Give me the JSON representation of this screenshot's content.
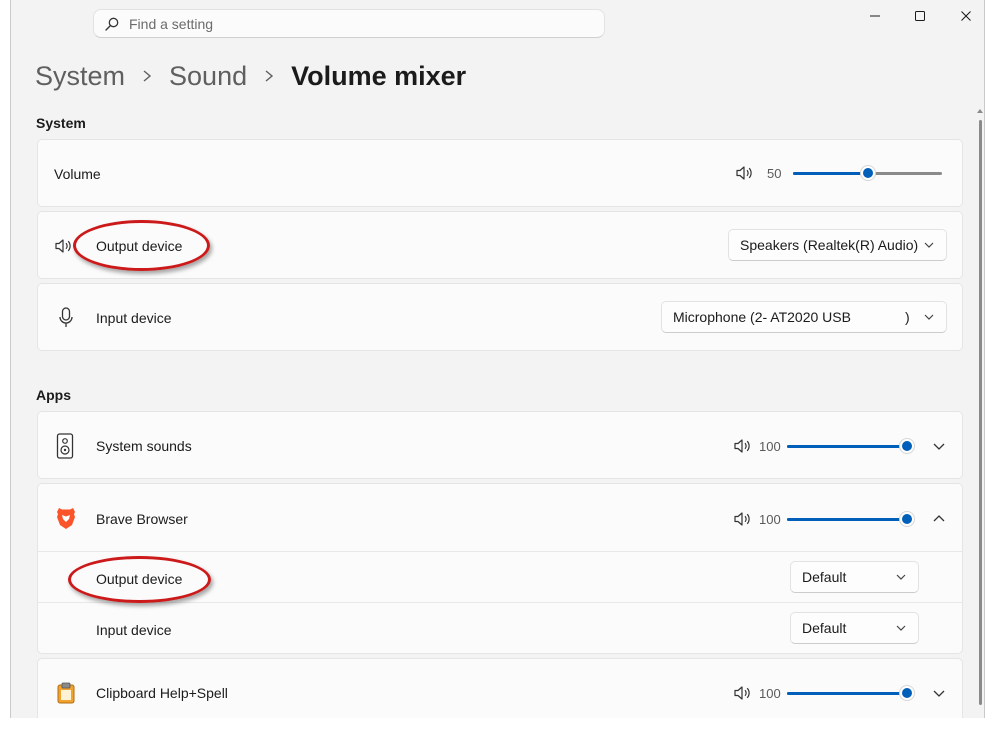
{
  "search": {
    "placeholder": "Find a setting"
  },
  "breadcrumb": {
    "items": [
      "System",
      "Sound",
      "Volume mixer"
    ]
  },
  "system_section": {
    "label": "System",
    "volume": {
      "label": "Volume",
      "value": "50",
      "level": 0.5
    },
    "output": {
      "label": "Output device",
      "selected": "Speakers (Realtek(R) Audio)"
    },
    "input": {
      "label": "Input device",
      "selected": "Microphone (2- AT2020 USB",
      "suffix": ")"
    }
  },
  "apps_section": {
    "label": "Apps",
    "system_sounds": {
      "label": "System sounds",
      "value": "100",
      "level": 1.0
    },
    "brave": {
      "label": "Brave Browser",
      "value": "100",
      "level": 1.0,
      "output_label": "Output device",
      "output_selected": "Default",
      "input_label": "Input device",
      "input_selected": "Default"
    },
    "clipboard": {
      "label": "Clipboard Help+Spell",
      "value": "100",
      "level": 1.0
    }
  },
  "colors": {
    "accent": "#005fb8",
    "annotation": "#cc1a1a",
    "brave_orange": "#fb542b",
    "clipboard_orange": "#f0a330"
  },
  "icons": [
    "search-icon",
    "minimize-icon",
    "maximize-icon",
    "close-icon",
    "speaker-icon",
    "microphone-icon",
    "system-sounds-icon",
    "brave-icon",
    "clipboard-icon",
    "chevron-down-icon",
    "chevron-up-icon"
  ]
}
